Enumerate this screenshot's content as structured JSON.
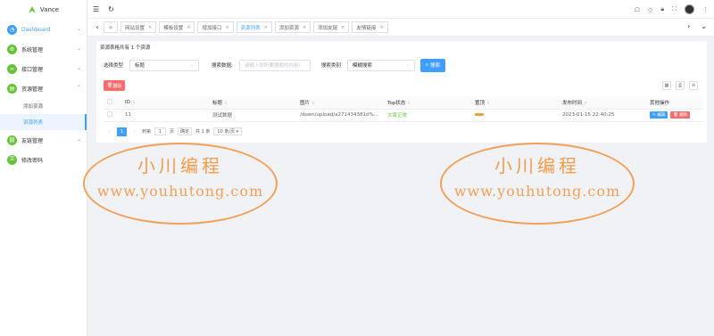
{
  "app": {
    "name": "Vance"
  },
  "sidebar": {
    "items": [
      {
        "label": "Dashboard",
        "icon": "speedometer-icon",
        "color": "#409eff",
        "active": true
      },
      {
        "label": "系统管理",
        "icon": "gear-icon",
        "color": "#67c23a"
      },
      {
        "label": "接口管理",
        "icon": "link-icon",
        "color": "#67c23a"
      },
      {
        "label": "资源管理",
        "icon": "folder-icon",
        "color": "#67c23a"
      },
      {
        "label": "友链管理",
        "icon": "chain-icon",
        "color": "#67c23a"
      },
      {
        "label": "修改密码",
        "icon": "lock-icon",
        "color": "#67c23a"
      }
    ],
    "sub_items": [
      {
        "label": "添加资源"
      },
      {
        "label": "资源列表",
        "active": true
      }
    ]
  },
  "tabs": [
    {
      "label": "网站设置"
    },
    {
      "label": "模板设置"
    },
    {
      "label": "增加接口"
    },
    {
      "label": "资源列表",
      "active": true
    },
    {
      "label": "添加资源"
    },
    {
      "label": "添加友链"
    },
    {
      "label": "友情链接"
    }
  ],
  "content": {
    "info": "资源表格共有 1 个资源",
    "filter_type_label": "选择类型",
    "filter_type_value": "标题",
    "search_label": "搜索数据:",
    "search_placeholder": "请输入你所要搜索的内容!",
    "search_category_label": "搜索类别",
    "search_category_value": "模糊搜索",
    "search_button": "搜索",
    "delete_button": "删除",
    "columns": [
      "ID",
      "标题",
      "图片",
      "Top状态",
      "置顶",
      "发布时间",
      "其他操作"
    ],
    "rows": [
      {
        "id": "11",
        "title": "测试数据",
        "image": "/down/upload/a271434381d%...",
        "top_status": "文章正常",
        "publish_time": "2023-01-15 22:40:25",
        "edit": "编辑",
        "delete": "删除"
      }
    ],
    "pager": {
      "current": "1",
      "goto_label": "到第",
      "goto_value": "1",
      "page_unit": "页",
      "confirm": "确定",
      "total": "共 1 条",
      "page_size": "10 条/页"
    }
  },
  "watermark": {
    "cn": "小川编程",
    "en": "www.youhutong.com"
  }
}
